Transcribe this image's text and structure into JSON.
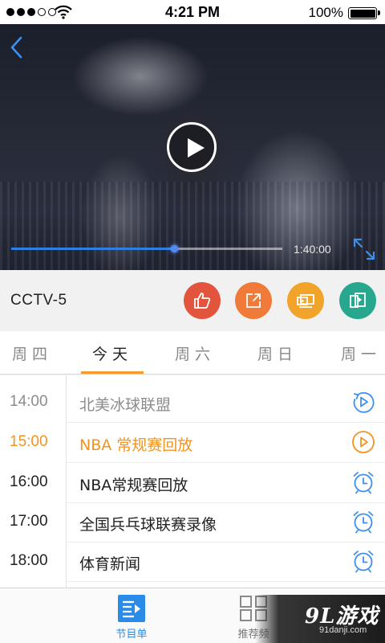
{
  "status_bar": {
    "time": "4:21 PM",
    "battery": "100%",
    "signal_icon": "signal-dots-icon",
    "wifi_icon": "wifi-icon",
    "battery_icon": "battery-icon"
  },
  "player": {
    "back_icon": "chevron-left-icon",
    "play_icon": "play-icon",
    "fullscreen_icon": "fullscreen-icon",
    "duration": "1:40:00",
    "progress": 0.6,
    "accent": "#2e7fe0"
  },
  "channel": {
    "name": "CCTV-5",
    "actions": [
      {
        "icon": "thumbs-up-icon",
        "color": "#e2543c"
      },
      {
        "icon": "share-icon",
        "color": "#f07a3a"
      },
      {
        "icon": "cast-screen-icon",
        "color": "#f2a42a"
      },
      {
        "icon": "switch-screen-icon",
        "color": "#27a88e"
      }
    ]
  },
  "day_tabs": {
    "items": [
      "周四",
      "今天",
      "周六",
      "周日",
      "周一"
    ],
    "active_index": 1,
    "accent": "#f39c28"
  },
  "schedule": [
    {
      "time": "14:00",
      "title": "北美冰球联盟",
      "state": "past",
      "icon": "replay-icon"
    },
    {
      "time": "15:00",
      "title": "NBA 常规赛回放",
      "state": "live",
      "icon": "play-circle-icon"
    },
    {
      "time": "16:00",
      "title": "NBA常规赛回放",
      "state": "upcoming",
      "icon": "alarm-clock-icon"
    },
    {
      "time": "17:00",
      "title": "全国兵乓球联赛录像",
      "state": "upcoming",
      "icon": "alarm-clock-icon"
    },
    {
      "time": "18:00",
      "title": "体育新闻",
      "state": "upcoming",
      "icon": "alarm-clock-icon"
    }
  ],
  "bottom_nav": {
    "items": [
      {
        "label": "节目单",
        "icon": "program-list-icon",
        "active": true
      },
      {
        "label": "推荐频",
        "icon": "grid-icon",
        "active": false
      }
    ],
    "accent": "#2a8ce8"
  },
  "watermark": {
    "logo": "9L游戏",
    "url": "91danji.com"
  }
}
